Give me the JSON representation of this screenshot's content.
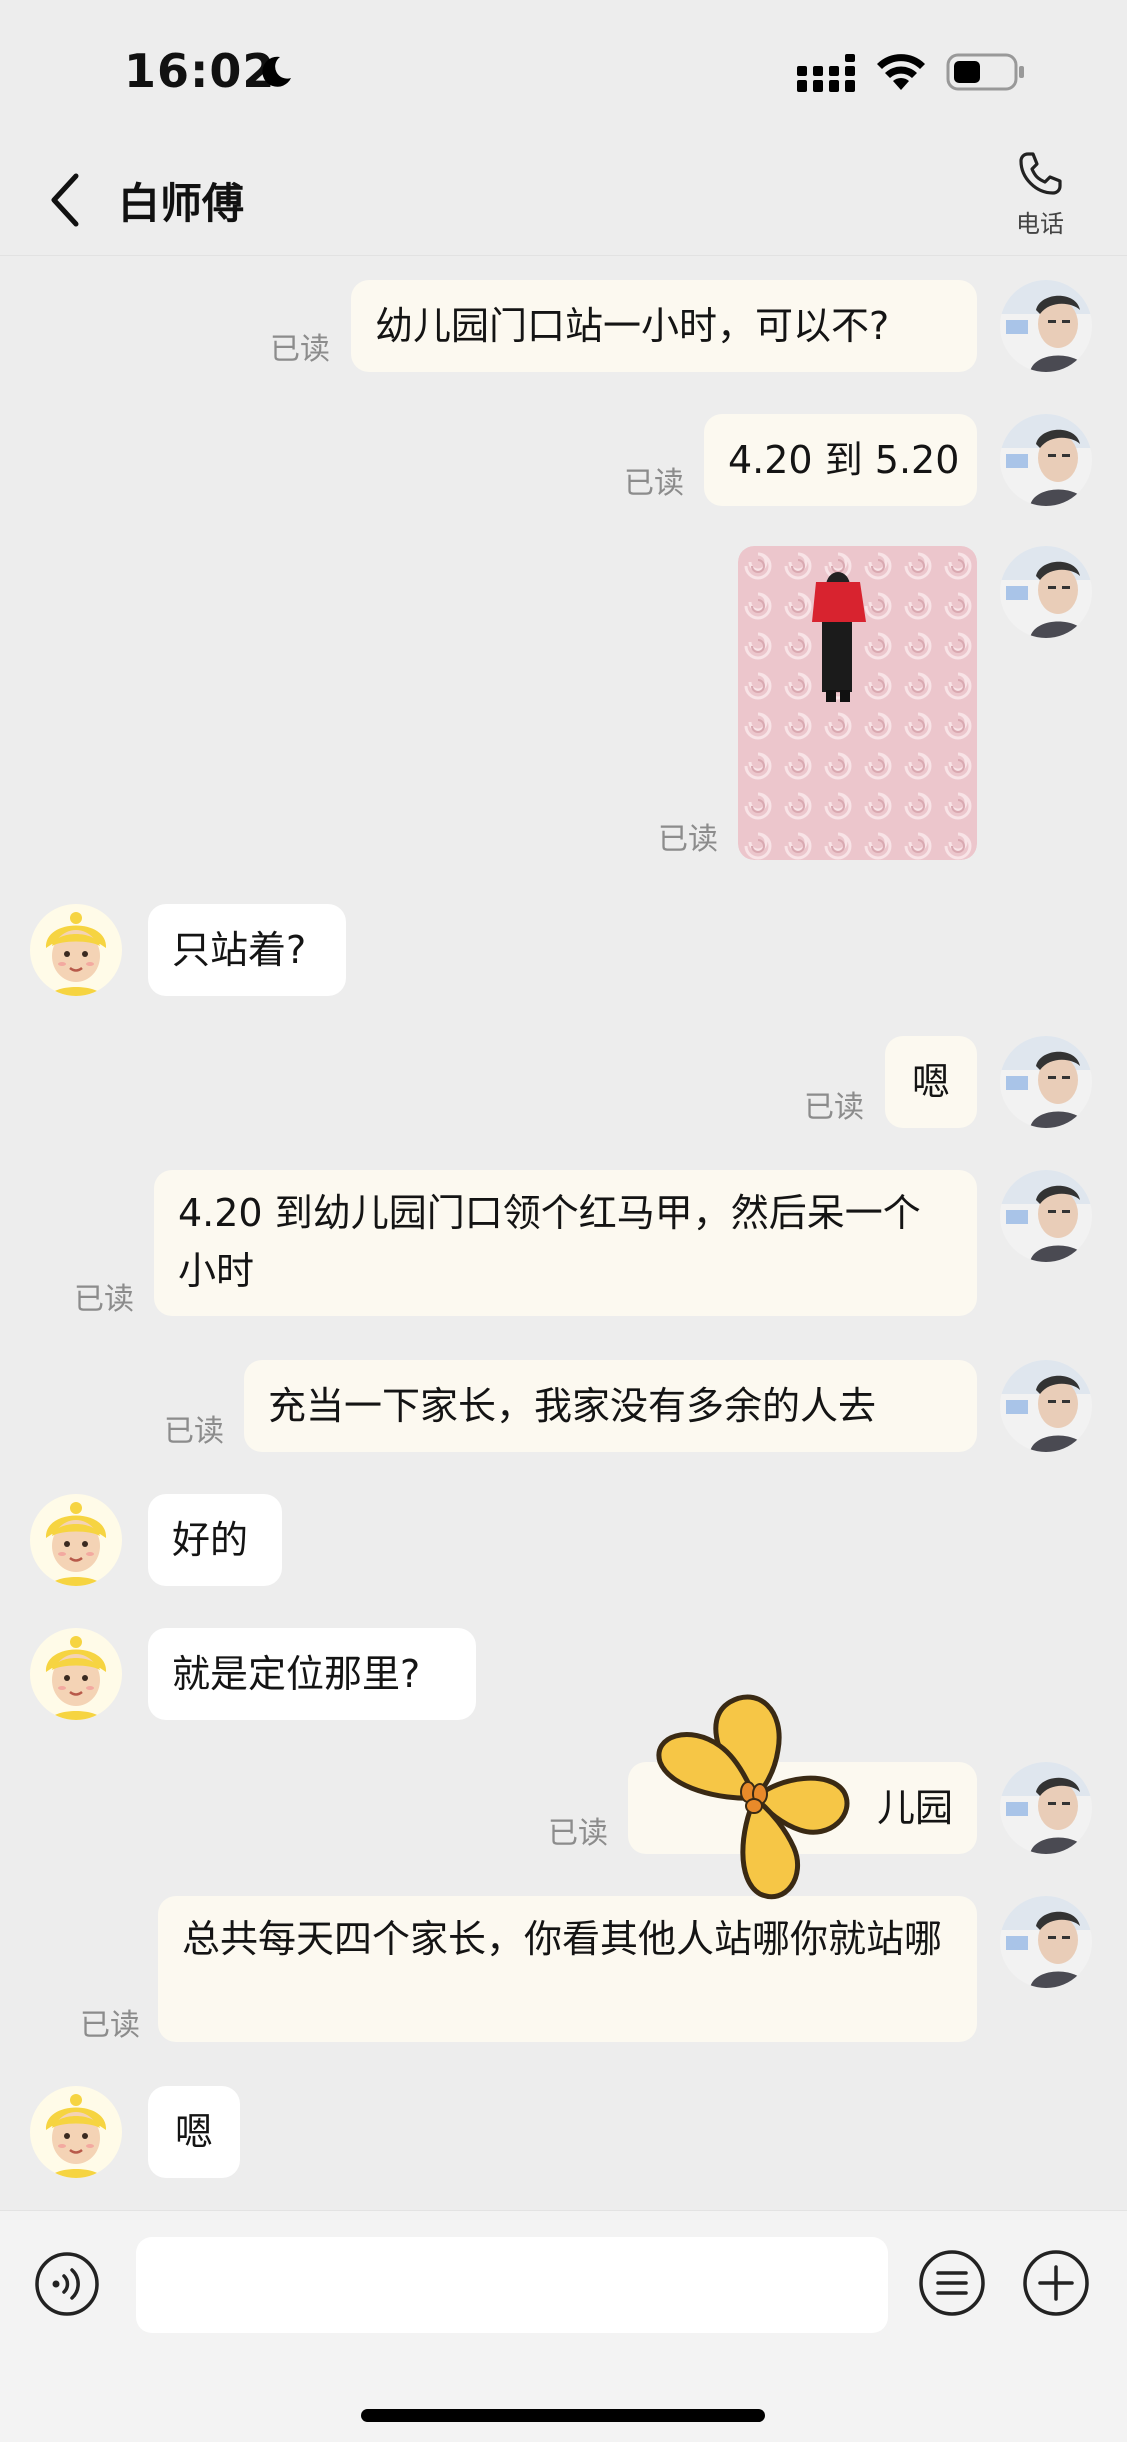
{
  "status_bar": {
    "time": "16:02"
  },
  "header": {
    "title": "白师傅",
    "call_label": "电话"
  },
  "messages": [
    {
      "side": "out",
      "text": "幼儿园门口站一小时，可以不?",
      "read": "已读"
    },
    {
      "side": "out",
      "text": "4.20 到 5.20",
      "read": "已读"
    },
    {
      "side": "out",
      "type": "image",
      "read": "已读"
    },
    {
      "side": "in",
      "text": "只站着?"
    },
    {
      "side": "out",
      "text": "嗯",
      "read": "已读"
    },
    {
      "side": "out",
      "text": "4.20 到幼儿园门口领个红马甲，然后呆一个小时",
      "read": "已读"
    },
    {
      "side": "out",
      "text": "充当一下家长，我家没有多余的人去",
      "read": "已读"
    },
    {
      "side": "in",
      "text": "好的"
    },
    {
      "side": "in",
      "text": "就是定位那里?"
    },
    {
      "side": "out",
      "text": "儿园",
      "read": "已读"
    },
    {
      "side": "out",
      "text": "总共每天四个家长，你看其他人站哪你就站哪",
      "read": "已读"
    },
    {
      "side": "in",
      "text": "嗯"
    }
  ],
  "colors": {
    "outgoing_bubble": "#fcf9f0",
    "incoming_bubble": "#ffffff",
    "background": "#ededed"
  }
}
